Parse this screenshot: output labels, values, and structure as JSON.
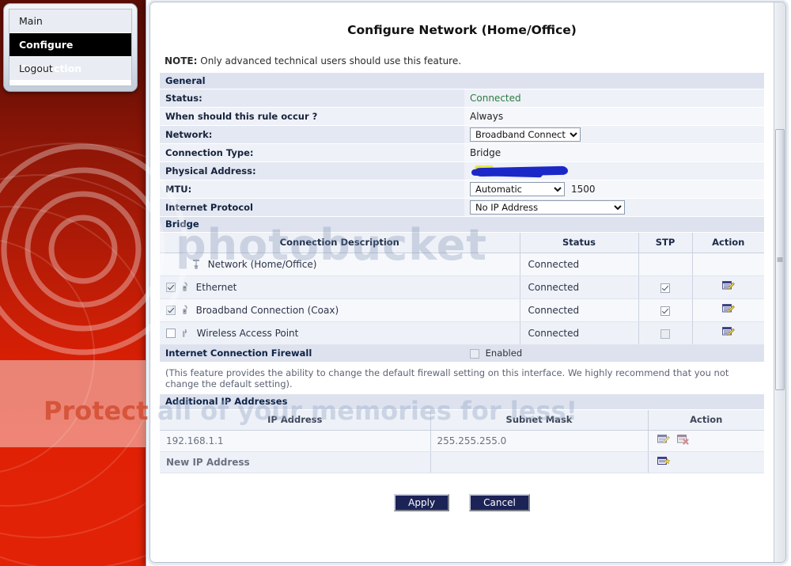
{
  "desktop_menu": {
    "items": [
      {
        "label": "Main",
        "selected": false
      },
      {
        "label": "Configure Connection",
        "selected": true
      },
      {
        "label": "Logout",
        "selected": false
      }
    ]
  },
  "page": {
    "title": "Configure Network (Home/Office)",
    "note_label": "NOTE:",
    "note_text": " Only advanced technical users should use this feature."
  },
  "general": {
    "section_title": "General",
    "rows": [
      {
        "label": "Status:",
        "value": "Connected",
        "kind": "status"
      },
      {
        "label": "When should this rule occur ?",
        "value": "Always",
        "kind": "text"
      },
      {
        "label": "Network:",
        "value": "Broadband Connection",
        "kind": "select"
      },
      {
        "label": "Connection Type:",
        "value": "Bridge",
        "kind": "text"
      },
      {
        "label": "Physical Address:",
        "value": "",
        "kind": "redacted"
      },
      {
        "label": "MTU:",
        "value": "Automatic",
        "extra": "1500",
        "kind": "select-mtu"
      },
      {
        "label": "Internet Protocol",
        "value": "No IP Address",
        "kind": "select"
      }
    ],
    "network_options": [
      "Broadband Connection"
    ],
    "mtu_options": [
      "Automatic"
    ],
    "protocol_options": [
      "No IP Address"
    ]
  },
  "bridge": {
    "section_title": "Bridge",
    "columns": [
      "Connection Description",
      "Status",
      "STP",
      "Action"
    ],
    "rows": [
      {
        "description": "Network (Home/Office)",
        "status": "Connected",
        "has_checkbox": false,
        "checked": false,
        "stp_present": false,
        "stp_checked": false,
        "action": false,
        "icon": "network-tree-icon",
        "depth": 0
      },
      {
        "description": "Ethernet",
        "status": "Connected",
        "has_checkbox": true,
        "checked": true,
        "stp_present": true,
        "stp_checked": true,
        "action": true,
        "icon": "ethernet-port-icon",
        "depth": 1
      },
      {
        "description": "Broadband Connection (Coax)",
        "status": "Connected",
        "has_checkbox": true,
        "checked": true,
        "stp_present": true,
        "stp_checked": true,
        "action": true,
        "icon": "coax-port-icon",
        "depth": 1
      },
      {
        "description": "Wireless Access Point",
        "status": "Connected",
        "has_checkbox": true,
        "checked": false,
        "stp_present": true,
        "stp_checked": false,
        "action": true,
        "icon": "wireless-antenna-icon",
        "depth": 1
      }
    ]
  },
  "firewall": {
    "section_title": "Internet Connection Firewall",
    "checkbox_label": "Enabled",
    "enabled": false,
    "description": "(This feature provides the ability to change the default firewall setting on this interface. We highly recommend that you not change the default setting)."
  },
  "additional_ip": {
    "section_title": "Additional IP Addresses",
    "columns": [
      "IP Address",
      "Subnet Mask",
      "Action"
    ],
    "rows": [
      {
        "ip": "192.168.1.1",
        "mask": "255.255.255.0",
        "actions": [
          "edit-icon",
          "delete-icon"
        ]
      }
    ],
    "new_row_label": "New IP Address",
    "new_row_action": "add-icon"
  },
  "buttons": {
    "apply": "Apply",
    "cancel": "Cancel"
  },
  "watermark": {
    "word": "photobucket",
    "tagline_pale": "Protect all of your memories ",
    "tagline_red": "Protect",
    "tagline_rest": "all of your memories for less!"
  },
  "colors": {
    "accent_blue": "#1c2356",
    "status_green": "#2c7a3f",
    "section_header": "#dde2ee",
    "desktop_red": "#c21d06",
    "selected_menu": "#000000"
  }
}
